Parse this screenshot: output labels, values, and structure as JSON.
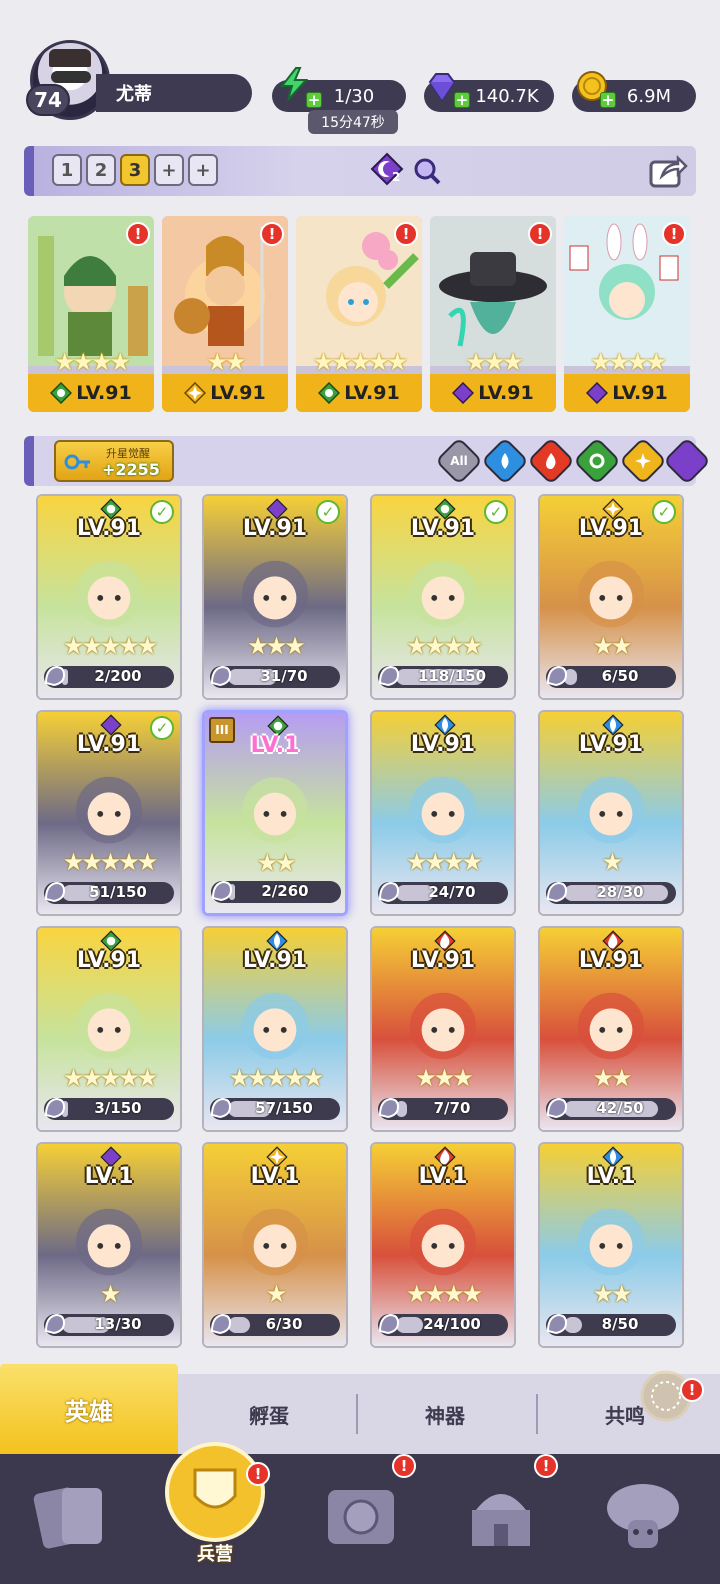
{
  "player": {
    "level": "74",
    "name": "尤蒂"
  },
  "resources": {
    "energy": "1/30",
    "energy_timer": "15分47秒",
    "gems": "140.7K",
    "gold": "6.9M"
  },
  "team": {
    "tabs": [
      "1",
      "2",
      "3",
      "+",
      "+"
    ],
    "active_tab": "3",
    "counter_badge": "2",
    "slots": [
      {
        "level": "LV.91",
        "element": "nature",
        "stars": 4,
        "alert": "!"
      },
      {
        "level": "LV.91",
        "element": "light",
        "stars": 2,
        "alert": "!"
      },
      {
        "level": "LV.91",
        "element": "nature",
        "stars": 5,
        "alert": "!"
      },
      {
        "level": "LV.91",
        "element": "dark",
        "stars": 3,
        "alert": "!"
      },
      {
        "level": "LV.91",
        "element": "dark",
        "stars": 4,
        "alert": "!"
      }
    ]
  },
  "filter": {
    "awaken_label": "升星觉醒",
    "awaken_value": "+2255",
    "all_label": "All",
    "elements": [
      "water",
      "fire",
      "nature",
      "light",
      "dark"
    ]
  },
  "heroes": [
    {
      "level": "LV.91",
      "element": "nature",
      "progress": "2/200",
      "ratio": 0.01,
      "checked": true,
      "stars": 5
    },
    {
      "level": "LV.91",
      "element": "dark",
      "progress": "31/70",
      "ratio": 0.44,
      "checked": true,
      "stars": 3
    },
    {
      "level": "LV.91",
      "element": "nature",
      "progress": "118/150",
      "ratio": 0.79,
      "checked": true,
      "stars": 4
    },
    {
      "level": "LV.91",
      "element": "light",
      "progress": "6/50",
      "ratio": 0.12,
      "checked": true,
      "stars": 2
    },
    {
      "level": "LV.91",
      "element": "dark",
      "progress": "51/150",
      "ratio": 0.34,
      "checked": true,
      "stars": 5
    },
    {
      "level": "LV.1",
      "element": "nature",
      "progress": "2/260",
      "ratio": 0.01,
      "checked": false,
      "stars": 2,
      "tier": "III",
      "selected": true
    },
    {
      "level": "LV.91",
      "element": "water",
      "progress": "24/70",
      "ratio": 0.34,
      "checked": false,
      "stars": 4
    },
    {
      "level": "LV.91",
      "element": "water",
      "progress": "28/30",
      "ratio": 0.93,
      "checked": false,
      "stars": 1
    },
    {
      "level": "LV.91",
      "element": "nature",
      "progress": "3/150",
      "ratio": 0.02,
      "checked": false,
      "stars": 5
    },
    {
      "level": "LV.91",
      "element": "water",
      "progress": "57/150",
      "ratio": 0.38,
      "checked": false,
      "stars": 5
    },
    {
      "level": "LV.91",
      "element": "fire",
      "progress": "7/70",
      "ratio": 0.1,
      "checked": false,
      "stars": 3
    },
    {
      "level": "LV.91",
      "element": "fire",
      "progress": "42/50",
      "ratio": 0.84,
      "checked": false,
      "stars": 2
    },
    {
      "level": "LV.1",
      "element": "dark",
      "progress": "13/30",
      "ratio": 0.43,
      "checked": false,
      "stars": 1
    },
    {
      "level": "LV.1",
      "element": "light",
      "progress": "6/30",
      "ratio": 0.2,
      "checked": false,
      "stars": 1
    },
    {
      "level": "LV.1",
      "element": "fire",
      "progress": "24/100",
      "ratio": 0.24,
      "checked": false,
      "stars": 4
    },
    {
      "level": "LV.1",
      "element": "water",
      "progress": "8/50",
      "ratio": 0.16,
      "checked": false,
      "stars": 2
    }
  ],
  "subnav": {
    "heroes": "英雄",
    "eggs": "孵蛋",
    "artifacts": "神器",
    "resonance": "共鸣"
  },
  "bottom_nav": {
    "barracks": "兵营",
    "alerts": "!"
  },
  "colors": {
    "nature": "#3aa23a",
    "light": "#f0b51d",
    "dark": "#7b3fc9",
    "water": "#2e8fe0",
    "fire": "#e23a24",
    "card_gold": "#f2c12c",
    "accent_purple": "#6a5fb8"
  }
}
